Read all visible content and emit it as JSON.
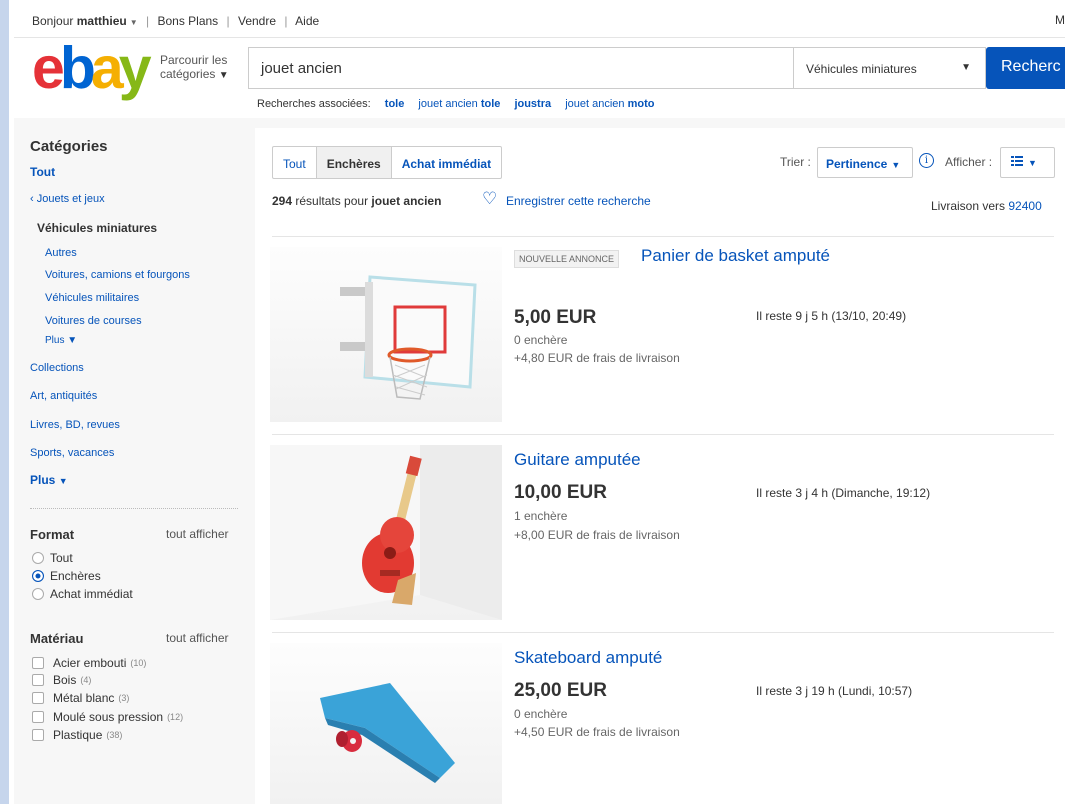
{
  "topbar": {
    "greeting": "Bonjour",
    "user": "matthieu",
    "links": [
      "Bons Plans",
      "Vendre",
      "Aide"
    ],
    "right_text": "M"
  },
  "header": {
    "logo_letters": [
      "e",
      "b",
      "a",
      "y"
    ],
    "browse_line1": "Parcourir les",
    "browse_line2": "catégories",
    "search_value": "jouet ancien",
    "category_selected": "Véhicules miniatures",
    "search_button": "Recherc"
  },
  "related": {
    "label": "Recherches associées:",
    "items": [
      {
        "plain": "",
        "bold": "tole"
      },
      {
        "plain": "jouet ancien ",
        "bold": "tole"
      },
      {
        "plain": "",
        "bold": "joustra"
      },
      {
        "plain": "jouet ancien ",
        "bold": "moto"
      }
    ]
  },
  "sidebar": {
    "title": "Catégories",
    "all": "Tout",
    "parent": "‹ Jouets et jeux",
    "current": "Véhicules miniatures",
    "subcats": [
      "Autres",
      "Voitures, camions et fourgons",
      "Véhicules militaires",
      "Voitures de courses"
    ],
    "sub_more": "Plus",
    "cats": [
      "Collections",
      "Art, antiquités",
      "Livres, BD, revues",
      "Sports, vacances"
    ],
    "more": "Plus",
    "format": {
      "title": "Format",
      "show_all": "tout afficher",
      "options": [
        "Tout",
        "Enchères",
        "Achat immédiat"
      ],
      "selected": "Enchères"
    },
    "material": {
      "title": "Matériau",
      "show_all": "tout afficher",
      "options": [
        {
          "label": "Acier embouti",
          "count": "(10)"
        },
        {
          "label": "Bois",
          "count": "(4)"
        },
        {
          "label": "Métal blanc",
          "count": "(3)"
        },
        {
          "label": "Moulé sous pression",
          "count": "(12)"
        },
        {
          "label": "Plastique",
          "count": "(38)"
        }
      ]
    }
  },
  "toolbar": {
    "tabs": [
      "Tout",
      "Enchères",
      "Achat immédiat"
    ],
    "active_tab": "Enchères",
    "sort_label": "Trier :",
    "sort_value": "Pertinence",
    "view_label": "Afficher :"
  },
  "results": {
    "count": "294",
    "text": "résultats pour",
    "query": "jouet ancien",
    "save_search": "Enregistrer cette recherche",
    "delivery_label": "Livraison vers",
    "delivery_zip": "92400"
  },
  "listings": [
    {
      "badge": "NOUVELLE ANNONCE",
      "title": "Panier de basket amputé",
      "price": "5,00 EUR",
      "bids": "0 enchère",
      "shipping": "+4,80 EUR de frais de livraison",
      "time_left": "Il reste 9 j 5 h (13/10, 20:49)"
    },
    {
      "badge": "",
      "title": "Guitare amputée",
      "price": "10,00 EUR",
      "bids": "1 enchère",
      "shipping": "+8,00 EUR de frais de livraison",
      "time_left": "Il reste 3 j 4 h (Dimanche, 19:12)"
    },
    {
      "badge": "",
      "title": "Skateboard amputé",
      "price": "25,00 EUR",
      "bids": "0 enchère",
      "shipping": "+4,50 EUR de frais de livraison",
      "time_left": "Il reste 3 j 19 h (Lundi, 10:57)"
    }
  ],
  "colors": {
    "link": "#0654ba",
    "logo_e": "#e53238",
    "logo_b": "#0064d2",
    "logo_a": "#f5af02",
    "logo_y": "#86b817"
  }
}
